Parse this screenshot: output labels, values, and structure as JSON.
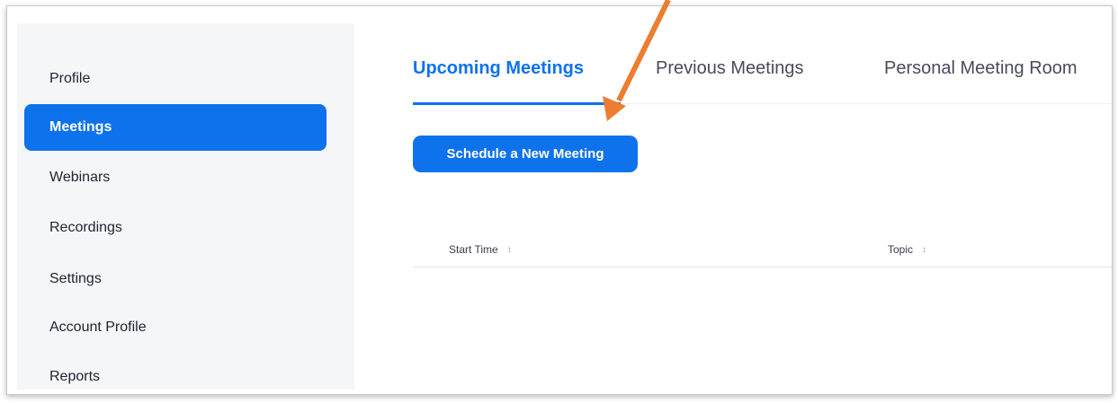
{
  "sidebar": {
    "items": [
      {
        "label": "Profile",
        "active": false
      },
      {
        "label": "Meetings",
        "active": true
      },
      {
        "label": "Webinars",
        "active": false
      },
      {
        "label": "Recordings",
        "active": false
      },
      {
        "label": "Settings",
        "active": false
      },
      {
        "label": "Account Profile",
        "active": false
      },
      {
        "label": "Reports",
        "active": false
      }
    ]
  },
  "tabs": [
    {
      "label": "Upcoming Meetings",
      "active": true
    },
    {
      "label": "Previous Meetings",
      "active": false
    },
    {
      "label": "Personal Meeting Room",
      "active": false
    }
  ],
  "actions": {
    "schedule_label": "Schedule a New Meeting"
  },
  "table": {
    "columns": [
      {
        "label": "Start Time",
        "sort_icon": "↕"
      },
      {
        "label": "Topic",
        "sort_icon": "↕"
      }
    ]
  },
  "colors": {
    "accent": "#0e72ed",
    "annotation_arrow": "#ed7d31"
  }
}
